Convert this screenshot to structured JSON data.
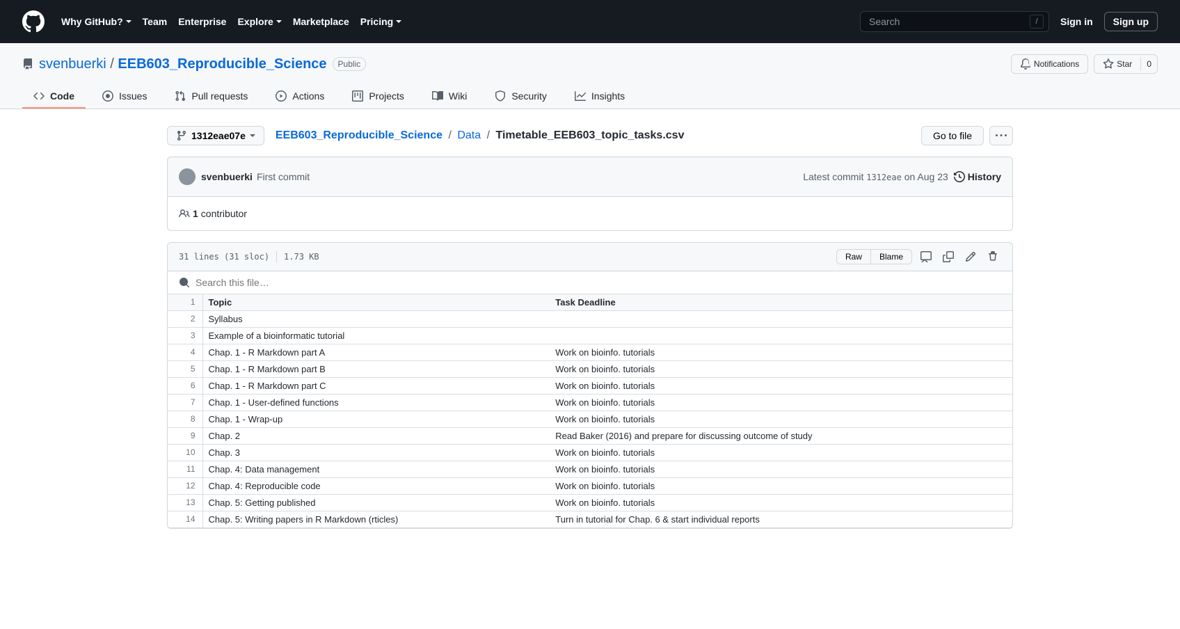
{
  "header": {
    "nav": [
      "Why GitHub?",
      "Team",
      "Enterprise",
      "Explore",
      "Marketplace",
      "Pricing"
    ],
    "search_placeholder": "Search",
    "slash": "/",
    "signin": "Sign in",
    "signup": "Sign up"
  },
  "repo": {
    "owner": "svenbuerki",
    "name": "EEB603_Reproducible_Science",
    "visibility": "Public",
    "notifications_label": "Notifications",
    "star_label": "Star",
    "star_count": "0"
  },
  "repo_nav": [
    {
      "label": "Code",
      "icon": "code",
      "active": true
    },
    {
      "label": "Issues",
      "icon": "issue"
    },
    {
      "label": "Pull requests",
      "icon": "pr"
    },
    {
      "label": "Actions",
      "icon": "play"
    },
    {
      "label": "Projects",
      "icon": "project"
    },
    {
      "label": "Wiki",
      "icon": "book"
    },
    {
      "label": "Security",
      "icon": "shield"
    },
    {
      "label": "Insights",
      "icon": "graph"
    }
  ],
  "file_nav": {
    "branch": "1312eae07e",
    "breadcrumb_root": "EEB603_Reproducible_Science",
    "breadcrumb_folder": "Data",
    "breadcrumb_file": "Timetable_EEB603_topic_tasks.csv",
    "goto_file": "Go to file"
  },
  "commit": {
    "author": "svenbuerki",
    "message": "First commit",
    "latest_label": "Latest commit",
    "sha": "1312eae",
    "date": "on Aug 23",
    "history_label": "History",
    "contributors_count": "1",
    "contributors_label": "contributor"
  },
  "file": {
    "info_lines": "31 lines (31 sloc)",
    "info_size": "1.73 KB",
    "raw_label": "Raw",
    "blame_label": "Blame",
    "search_placeholder": "Search this file…"
  },
  "csv": {
    "headers": [
      "Topic",
      "Task Deadline"
    ],
    "rows": [
      [
        "Syllabus",
        ""
      ],
      [
        "Example of a bioinformatic tutorial",
        ""
      ],
      [
        "Chap. 1 - R Markdown part A",
        "Work on bioinfo. tutorials"
      ],
      [
        "Chap. 1 - R Markdown part B",
        "Work on bioinfo. tutorials"
      ],
      [
        "Chap. 1 - R Markdown part C",
        "Work on bioinfo. tutorials"
      ],
      [
        "Chap. 1 - User-defined functions",
        "Work on bioinfo. tutorials"
      ],
      [
        "Chap. 1 - Wrap-up",
        "Work on bioinfo. tutorials"
      ],
      [
        "Chap. 2",
        "Read Baker (2016) and prepare for discussing outcome of study"
      ],
      [
        "Chap. 3",
        "Work on bioinfo. tutorials"
      ],
      [
        "Chap. 4: Data management",
        "Work on bioinfo. tutorials"
      ],
      [
        "Chap. 4: Reproducible code",
        "Work on bioinfo. tutorials"
      ],
      [
        "Chap. 5: Getting published",
        "Work on bioinfo. tutorials"
      ],
      [
        "Chap. 5: Writing papers in R Markdown (rticles)",
        "Turn in tutorial for Chap. 6 & start individual reports"
      ]
    ]
  }
}
